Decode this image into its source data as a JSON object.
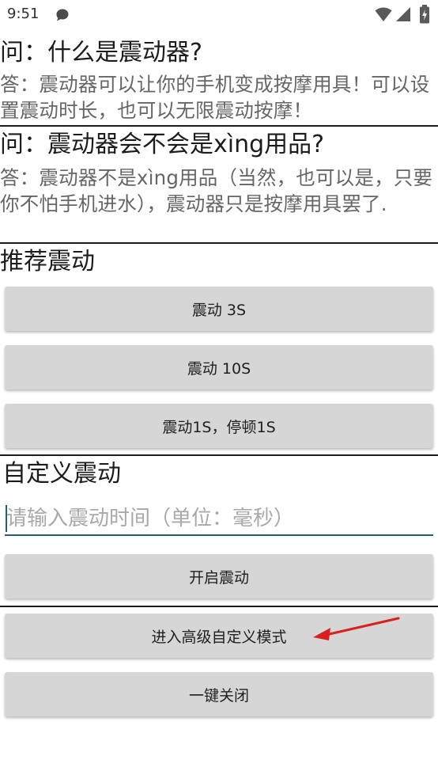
{
  "status_bar": {
    "time": "9:51"
  },
  "faq": [
    {
      "question": "问：什么是震动器?",
      "answer": "答：震动器可以让你的手机变成按摩用具！可以设置震动时长，也可以无限震动按摩！"
    },
    {
      "question": "问：震动器会不会是xìng用品?",
      "answer": "答：震动器不是xìng用品（当然，也可以是，只要你不怕手机进水），震动器只是按摩用具罢了."
    }
  ],
  "recommended": {
    "title": "推荐震动",
    "buttons": [
      "震动 3S",
      "震动 10S",
      "震动1S，停顿1S"
    ]
  },
  "custom": {
    "title": "自定义震动",
    "input_placeholder": "请输入震动时间（单位：毫秒）",
    "start_label": "开启震动"
  },
  "advanced_label": "进入高级自定义模式",
  "close_all_label": "一键关闭",
  "colors": {
    "accent": "#1f5e94",
    "button_bg": "#d6d6d6",
    "annotation_arrow": "#d9201f"
  }
}
